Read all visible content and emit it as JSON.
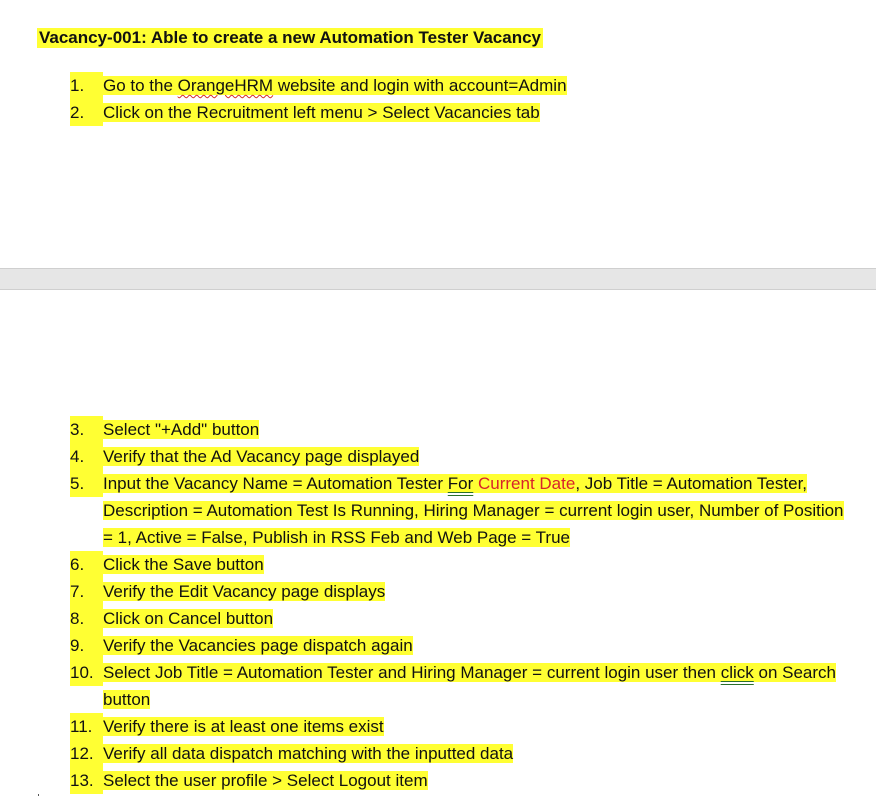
{
  "heading": "Vacancy-001: Able to create a new Automation Tester Vacancy",
  "steps_page1": [
    {
      "num": "1.",
      "pre": "Go to the ",
      "spell": "OrangeHRM",
      "post": " website and login with account=Admin"
    },
    {
      "num": "2.",
      "text": "Click on the Recruitment left menu > Select Vacancies tab"
    }
  ],
  "steps_page2": [
    {
      "num": "3.",
      "text": "Select \"+Add\" button"
    },
    {
      "num": "4.",
      "text": "Verify that the Ad Vacancy page displayed"
    },
    {
      "num": "5.",
      "pre": "Input the Vacancy Name = Automation Tester ",
      "grammar": "For",
      "space": " ",
      "field": "Current Date",
      "post": ", Job Title = Automation Tester, Description = Automation Test Is Running, Hiring Manager = current login user, Number of Position = 1, Active = False, Publish in RSS Feb and Web Page = True"
    },
    {
      "num": "6.",
      "text": "Click the Save button"
    },
    {
      "num": "7.",
      "text": "Verify the Edit Vacancy page displays"
    },
    {
      "num": "8.",
      "text": "Click on Cancel button"
    },
    {
      "num": "9.",
      "text": "Verify the Vacancies page dispatch again"
    },
    {
      "num": "10.",
      "pre": "Select Job Title = Automation Tester and Hiring Manager = current login user then ",
      "grammar": "click",
      "post": " on Search button"
    },
    {
      "num": "11.",
      "text": "Verify there is at least one items exist"
    },
    {
      "num": "12.",
      "text": "Verify all data dispatch matching with the inputted data"
    },
    {
      "num": "13.",
      "text": "Select the user profile > Select Logout item"
    }
  ],
  "colors": {
    "highlight": "#ffff33",
    "field_text": "#d8232a",
    "page_gap": "#e6e6e6"
  }
}
